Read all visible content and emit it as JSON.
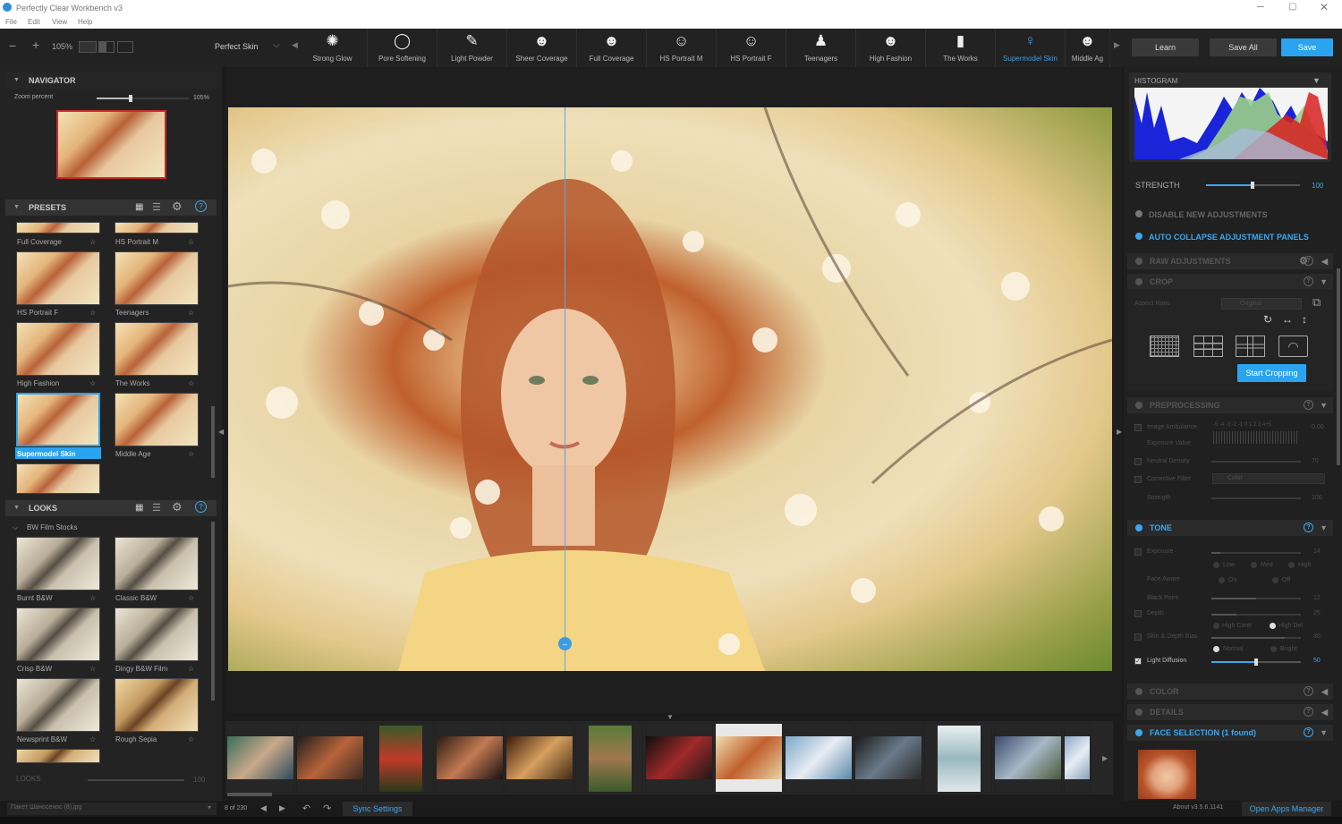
{
  "window": {
    "title": "Perfectly Clear Workbench v3"
  },
  "menu": [
    "File",
    "Edit",
    "View",
    "Help"
  ],
  "toolbar": {
    "zoom": "105%",
    "current_preset": "Perfect Skin",
    "presets": [
      {
        "label": "Strong Glow",
        "icon": "glow-icon"
      },
      {
        "label": "Pore Softening",
        "icon": "circle-icon"
      },
      {
        "label": "Light Powder",
        "icon": "brush-icon"
      },
      {
        "label": "Sheer Coverage",
        "icon": "head-icon"
      },
      {
        "label": "Full Coverage",
        "icon": "head-plus-icon"
      },
      {
        "label": "HS Portrait M",
        "icon": "head-outline-icon"
      },
      {
        "label": "HS Portrait F",
        "icon": "head-female-icon"
      },
      {
        "label": "Teenagers",
        "icon": "group-icon"
      },
      {
        "label": "High Fashion",
        "icon": "fashion-icon"
      },
      {
        "label": "The Works",
        "icon": "bars-icon"
      },
      {
        "label": "Supermodel Skin",
        "icon": "model-icon"
      },
      {
        "label": "Middle Ag",
        "icon": "head-icon"
      }
    ],
    "learn": "Learn",
    "save_all": "Save All",
    "save": "Save"
  },
  "navigator": {
    "title": "NAVIGATOR",
    "zoom_label": "Zoom percent",
    "zoom_value": "105%",
    "zoom_level": 0.37
  },
  "presets_panel": {
    "title": "PRESETS",
    "items": [
      "Full Coverage",
      "HS Portrait M",
      "HS Portrait F",
      "Teenagers",
      "High Fashion",
      "The Works",
      "Supermodel Skin",
      "Middle Age"
    ]
  },
  "looks_panel": {
    "title": "LOOKS",
    "group": "BW Film Stocks",
    "items": [
      "Burnt B&W",
      "Classic B&W",
      "Crisp B&W",
      "Dingy B&W Film",
      "Newsprint B&W",
      "Rough Sepia"
    ],
    "strength_label": "LOOKS",
    "strength_value": "100"
  },
  "histogram": {
    "title": "HISTOGRAM"
  },
  "right": {
    "strength_label": "STRENGTH",
    "strength_value": "100",
    "strength_level": 0.5,
    "disable_new": "DISABLE NEW ADJUSTMENTS",
    "auto_collapse": "AUTO COLLAPSE ADJUSTMENT PANELS",
    "raw": "RAW ADJUSTMENTS",
    "crop": "CROP",
    "aspect_ratio": "Aspect Ratio",
    "aspect_value": "Original",
    "start_cropping": "Start Cropping",
    "preprocessing": "PREPROCESSING",
    "pre_rows": [
      {
        "label": "Image Ambulance",
        "value": "0.00"
      },
      {
        "label": "Exposure Value",
        "value": ""
      },
      {
        "label": "Neutral Density",
        "value": "70"
      },
      {
        "label": "Corrective Filter",
        "value": "Color"
      },
      {
        "label": "Strength",
        "value": "100"
      }
    ],
    "ambulance_scale": "-5 -4 -3 -2 -1 0 1 2 3 4+5",
    "tone": "TONE",
    "tone_rows": {
      "exposure": {
        "label": "Exposure",
        "value": "14"
      },
      "exposure_opts": [
        "Low",
        "Med",
        "High"
      ],
      "face_aware": "Face Aware",
      "face_opts": [
        "On",
        "Off"
      ],
      "black_point": {
        "label": "Black Point",
        "value": "12"
      },
      "depth": {
        "label": "Depth",
        "value": "25"
      },
      "depth_opts": [
        "High Contr",
        "High Def"
      ],
      "skin_depth": {
        "label": "Skin & Depth Bias",
        "value": "30"
      },
      "skin_opts": [
        "Normal",
        "Bright"
      ],
      "light_diffusion": {
        "label": "Light Diffusion",
        "value": "50"
      }
    },
    "color": "COLOR",
    "details": "DETAILS",
    "face_selection": "FACE SELECTION (1 found)"
  },
  "statusbar": {
    "filename": "Пакет Шаносенос (8).jpg",
    "counter": "8 of 230",
    "sync": "Sync Settings",
    "about": "About v3.5.6.1141",
    "open_apps": "Open Apps Manager"
  }
}
